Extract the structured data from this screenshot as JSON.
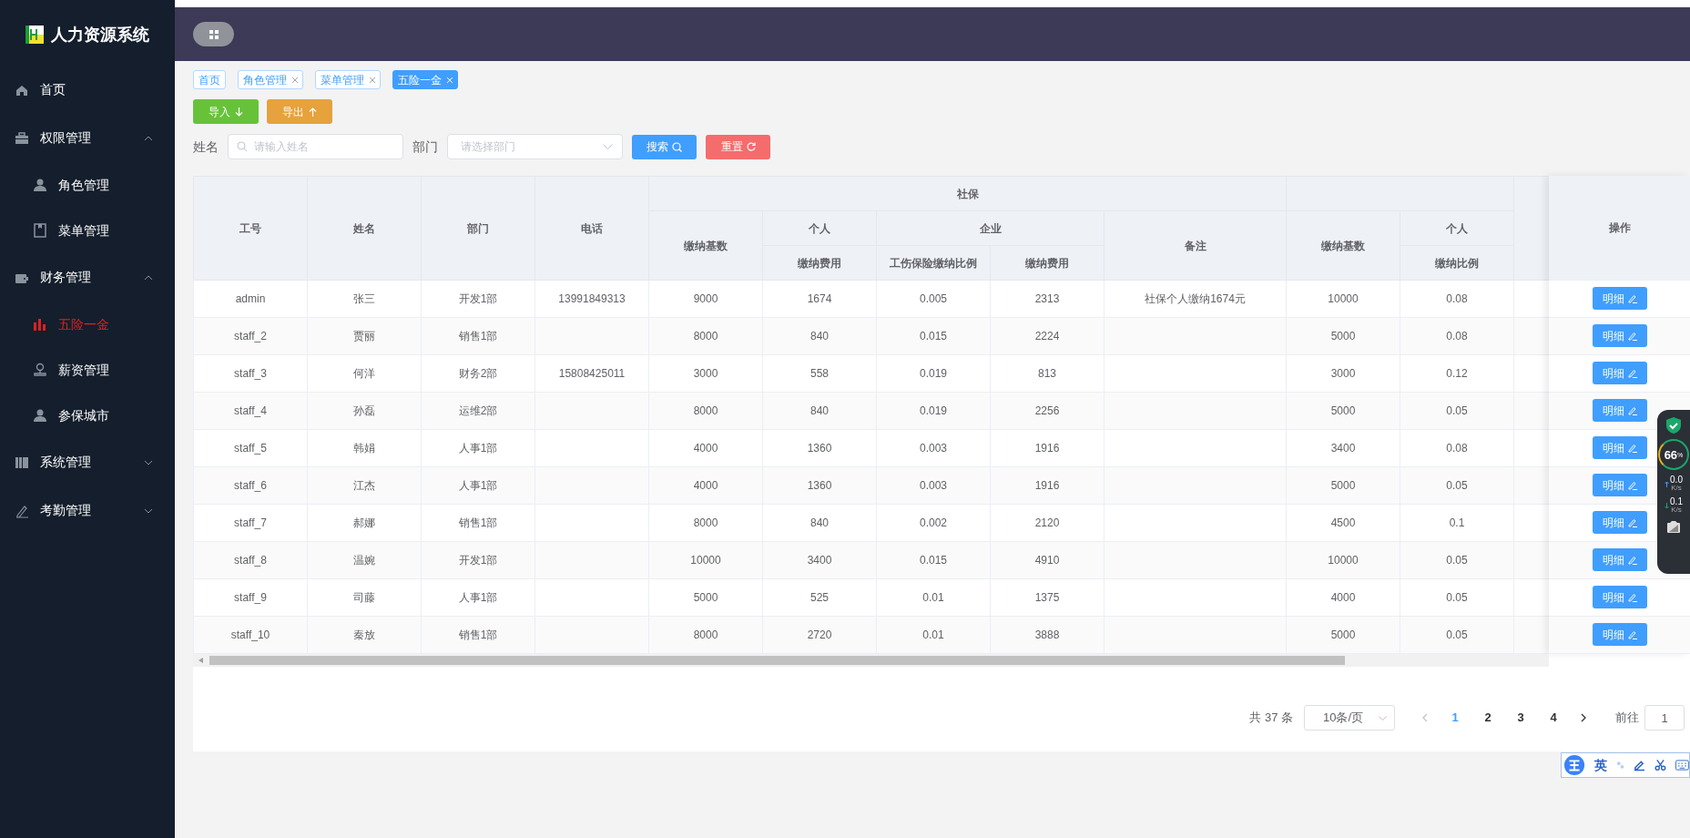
{
  "sidebar": {
    "logo_text": "人力资源系统",
    "items": [
      {
        "label": "首页",
        "kind": "link",
        "selected": false
      },
      {
        "label": "权限管理",
        "kind": "group",
        "expanded": true,
        "children": [
          {
            "label": "角色管理",
            "selected": false
          },
          {
            "label": "菜单管理",
            "selected": false
          }
        ]
      },
      {
        "label": "财务管理",
        "kind": "group",
        "expanded": true,
        "children": [
          {
            "label": "五险一金",
            "selected": true
          },
          {
            "label": "薪资管理",
            "selected": false
          },
          {
            "label": "参保城市",
            "selected": false
          }
        ]
      },
      {
        "label": "系统管理",
        "kind": "group",
        "expanded": false
      },
      {
        "label": "考勤管理",
        "kind": "group",
        "expanded": false
      }
    ]
  },
  "tags": [
    {
      "label": "首页",
      "closable": false,
      "selected": false
    },
    {
      "label": "角色管理",
      "closable": true,
      "selected": false
    },
    {
      "label": "菜单管理",
      "closable": true,
      "selected": false
    },
    {
      "label": "五险一金",
      "closable": true,
      "selected": true
    }
  ],
  "toolbar": [
    {
      "label": "导入",
      "kind": "import"
    },
    {
      "label": "导出",
      "kind": "export"
    }
  ],
  "filters": {
    "name_label": "姓名",
    "name_placeholder": "请输入姓名",
    "dept_label": "部门",
    "dept_placeholder": "请选择部门",
    "search_button": "搜索",
    "reset_button": "重置"
  },
  "table": {
    "columns": [
      {
        "label": "工号"
      },
      {
        "label": "姓名"
      },
      {
        "label": "部门"
      },
      {
        "label": "电话"
      },
      {
        "label": "社保",
        "colspan": 5,
        "children": [
          {
            "label": "缴纳基数"
          },
          {
            "label": "个人",
            "children": [
              {
                "label": "缴纳费用"
              }
            ]
          },
          {
            "label": "企业",
            "colspan": 2,
            "children": [
              {
                "label": "工伤保险缴纳比例"
              },
              {
                "label": "缴纳费用"
              }
            ]
          },
          {
            "label": "备注"
          }
        ]
      },
      {
        "children": [
          {
            "label": "缴纳基数"
          },
          {
            "label": "个人",
            "children": [
              {
                "label": "缴纳比例"
              }
            ]
          }
        ]
      }
    ],
    "action_column": "操作",
    "rows": [
      {
        "cells": [
          "admin",
          "张三",
          "开发1部",
          "13991849313",
          "9000",
          "1674",
          "0.005",
          "2313",
          "社保个人缴纳1674元",
          "10000",
          "0.08"
        ],
        "action": "明细"
      },
      {
        "cells": [
          "staff_2",
          "贾丽",
          "销售1部",
          null,
          "8000",
          "840",
          "0.015",
          "2224",
          null,
          "5000",
          "0.08"
        ],
        "action": "明细"
      },
      {
        "cells": [
          "staff_3",
          "何洋",
          "财务2部",
          "15808425011",
          "3000",
          "558",
          "0.019",
          "813",
          null,
          "3000",
          "0.12"
        ],
        "action": "明细"
      },
      {
        "cells": [
          "staff_4",
          "孙磊",
          "运维2部",
          null,
          "8000",
          "840",
          "0.019",
          "2256",
          null,
          "5000",
          "0.05"
        ],
        "action": "明细"
      },
      {
        "cells": [
          "staff_5",
          "韩娟",
          "人事1部",
          null,
          "4000",
          "1360",
          "0.003",
          "1916",
          null,
          "3400",
          "0.08"
        ],
        "action": "明细"
      },
      {
        "cells": [
          "staff_6",
          "江杰",
          "人事1部",
          null,
          "4000",
          "1360",
          "0.003",
          "1916",
          null,
          "5000",
          "0.05"
        ],
        "action": "明细"
      },
      {
        "cells": [
          "staff_7",
          "郝娜",
          "销售1部",
          null,
          "8000",
          "840",
          "0.002",
          "2120",
          null,
          "4500",
          "0.1"
        ],
        "action": "明细"
      },
      {
        "cells": [
          "staff_8",
          "温婉",
          "开发1部",
          null,
          "10000",
          "3400",
          "0.015",
          "4910",
          null,
          "10000",
          "0.05"
        ],
        "action": "明细"
      },
      {
        "cells": [
          "staff_9",
          "司藤",
          "人事1部",
          null,
          "5000",
          "525",
          "0.01",
          "1375",
          null,
          "4000",
          "0.05"
        ],
        "action": "明细"
      },
      {
        "cells": [
          "staff_10",
          "秦放",
          "销售1部",
          null,
          "8000",
          "2720",
          "0.01",
          "3888",
          null,
          "5000",
          "0.05"
        ],
        "action": "明细"
      }
    ]
  },
  "pagination": {
    "total": "共 37 条",
    "page_size": "10条/页",
    "pages": [
      {
        "label": "1",
        "selected": true
      },
      {
        "label": "2",
        "selected": false
      },
      {
        "label": "3",
        "selected": false
      },
      {
        "label": "4",
        "selected": false
      }
    ],
    "goto_label": "前往",
    "goto_value": "1"
  },
  "speed_monitor": {
    "percent": "66",
    "percent_sign": "%",
    "upload": "0.0",
    "upload_unit": "K/s",
    "download": "0.1",
    "download_unit": "K/s"
  },
  "ime_toolbar": {
    "mode": "英"
  }
}
